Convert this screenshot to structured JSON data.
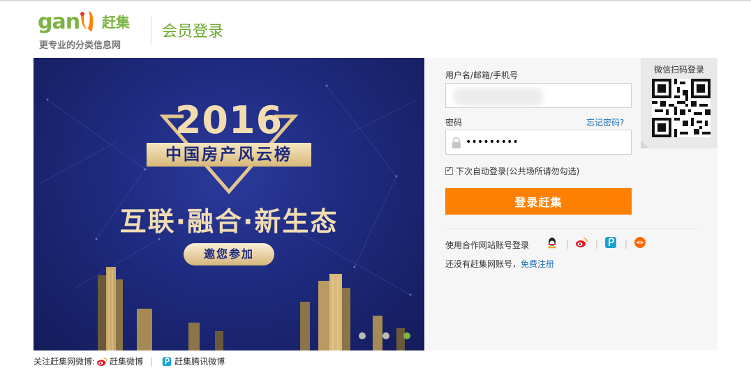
{
  "header": {
    "logo_word": "ganji",
    "logo_cn": "赶集",
    "tagline": "更专业的分类信息网",
    "page_title": "会员登录"
  },
  "banner": {
    "year": "2016",
    "subtitle": "中国房产风云榜",
    "headline": "互联·融合·新生态",
    "cta": "邀您参加",
    "slides": 3,
    "active_slide": 3
  },
  "login": {
    "username_label": "用户名/邮箱/手机号",
    "username_value": "",
    "password_label": "密码",
    "password_value": "•••••••••",
    "forgot_link": "忘记密码?",
    "remember_label": "下次自动登录(公共场所请勿勾选)",
    "remember_checked": true,
    "submit_label": "登录赶集",
    "partner_label": "使用合作网站账号登录",
    "partner_icons": [
      "qq-icon",
      "sina-weibo-icon",
      "tencent-weibo-icon",
      "taobao-icon"
    ],
    "no_account_text": "还没有赶集网账号，",
    "register_link": "免费注册",
    "qr_title": "微信扫码登录"
  },
  "footer": {
    "follow_label": "关注赶集网微博:",
    "weibo_link": "赶集微博",
    "tencent_link": "赶集腾讯微博"
  },
  "colors": {
    "accent_green": "#7cb342",
    "login_orange": "#ff7f00",
    "link_blue": "#1f6fb5",
    "banner_blue": "#1e2a7e"
  }
}
